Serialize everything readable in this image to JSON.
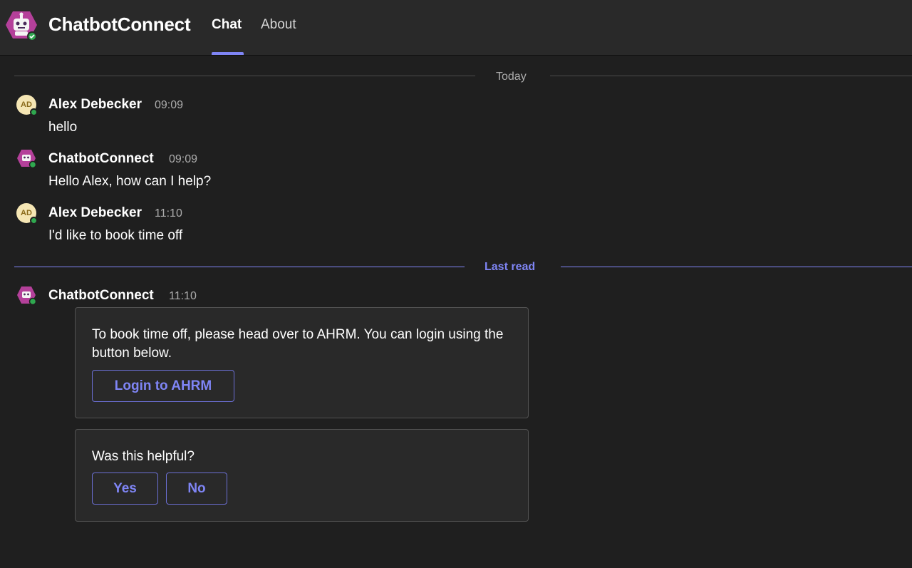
{
  "header": {
    "app_title": "ChatbotConnect",
    "app_logo_icon": "robot-hexagon-icon",
    "tabs": [
      {
        "label": "Chat",
        "active": true
      },
      {
        "label": "About",
        "active": false
      }
    ]
  },
  "dividers": {
    "today": "Today",
    "last_read": "Last read"
  },
  "messages": [
    {
      "sender": "Alex Debecker",
      "initials": "AD",
      "time": "09:09",
      "text": "hello"
    },
    {
      "sender": "ChatbotConnect",
      "time": "09:09",
      "text": "Hello Alex, how can I help?"
    },
    {
      "sender": "Alex Debecker",
      "initials": "AD",
      "time": "11:10",
      "text": "I'd like to book time off"
    },
    {
      "sender": "ChatbotConnect",
      "time": "11:10"
    }
  ],
  "cards": {
    "login": {
      "text": "To book time off, please head over to AHRM. You can login using the button below.",
      "button_label": "Login to AHRM"
    },
    "feedback": {
      "question": "Was this helpful?",
      "yes_label": "Yes",
      "no_label": "No"
    }
  },
  "colors": {
    "accent": "#7f85f5",
    "background": "#1f1f1f",
    "header_bg": "#292929",
    "bot_brand": "#b4409a",
    "presence_available": "#2fa84f"
  }
}
